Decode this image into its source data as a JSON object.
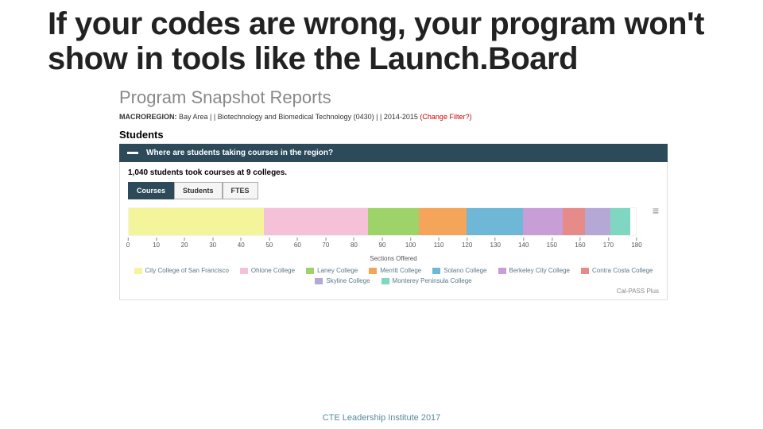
{
  "slide": {
    "title": "If your codes are wrong, your program won't show in tools like the Launch.Board",
    "footer": "CTE Leadership Institute 2017"
  },
  "snapshot": {
    "title": "Program Snapshot Reports",
    "filter_label": "MACROREGION:",
    "filter_value": "Bay Area | | Biotechnology and Biomedical Technology (0430) | | 2014-2015",
    "change_filter": "(Change Filter?)",
    "students_heading": "Students",
    "question": "Where are students taking courses in the region?",
    "summary": "1,040 students took courses at 9 colleges.",
    "tabs": [
      "Courses",
      "Students",
      "FTES"
    ],
    "xlabel": "Sections Offered",
    "credit": "Cal-PASS Plus"
  },
  "chart_data": {
    "type": "bar",
    "stacked": true,
    "orientation": "horizontal",
    "xlabel": "Sections Offered",
    "xlim": [
      0,
      180
    ],
    "ticks": [
      0,
      10,
      20,
      30,
      40,
      50,
      60,
      70,
      80,
      90,
      100,
      110,
      120,
      130,
      140,
      150,
      160,
      170,
      180
    ],
    "series": [
      {
        "name": "City College of San Francisco",
        "value": 48,
        "color": "#f4f49a"
      },
      {
        "name": "Ohlone College",
        "value": 37,
        "color": "#f4c1d8"
      },
      {
        "name": "Laney College",
        "value": 18,
        "color": "#9ed36a"
      },
      {
        "name": "Merritt College",
        "value": 17,
        "color": "#f5a55a"
      },
      {
        "name": "Solano College",
        "value": 20,
        "color": "#6fb7d6"
      },
      {
        "name": "Berkeley City College",
        "value": 14,
        "color": "#c79ed6"
      },
      {
        "name": "Contra Costa College",
        "value": 8,
        "color": "#e68a8a"
      },
      {
        "name": "Skyline College",
        "value": 9,
        "color": "#b5a8d6"
      },
      {
        "name": "Monterey Peninsula College",
        "value": 7,
        "color": "#7fd6c1"
      }
    ]
  }
}
